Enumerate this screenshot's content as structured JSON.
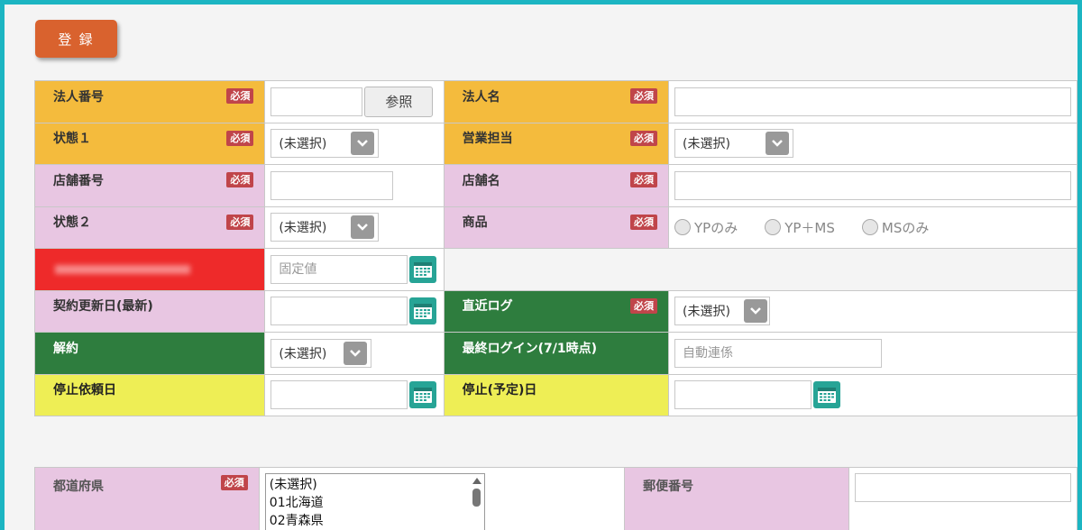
{
  "toolbar": {
    "register_label": "登 録"
  },
  "required_badge": "必須",
  "row1": {
    "corp_number_label": "法人番号",
    "corp_number_value": "",
    "ref_button": "参照",
    "corp_name_label": "法人名",
    "corp_name_value": ""
  },
  "row2": {
    "status1_label": "状態１",
    "status1_value": "(未選択)",
    "sales_label": "営業担当",
    "sales_value": "(未選択)"
  },
  "row3": {
    "store_number_label": "店舗番号",
    "store_number_value": "",
    "store_name_label": "店舗名",
    "store_name_value": ""
  },
  "row4": {
    "status2_label": "状態２",
    "status2_value": "(未選択)",
    "product_label": "商品",
    "product_options": [
      "YPのみ",
      "YP＋MS",
      "MSのみ"
    ]
  },
  "row5": {
    "fixed_value_placeholder": "固定値"
  },
  "row6": {
    "renewal_label": "契約更新日(最新)",
    "recent_log_label": "直近ログ",
    "recent_log_value": "(未選択)"
  },
  "row7": {
    "cancel_label": "解約",
    "cancel_value": "(未選択)",
    "last_login_label": "最終ログイン(7/1時点)",
    "last_login_placeholder": "自動連係"
  },
  "row8": {
    "stop_request_label": "停止依頼日",
    "stop_planned_label": "停止(予定)日"
  },
  "address": {
    "prefecture_label": "都道府県",
    "prefecture_options": [
      "(未選択)",
      "01北海道",
      "02青森県"
    ],
    "postal_label": "郵便番号",
    "postal_value": ""
  },
  "colors": {
    "orange": "#f4bb3d",
    "pink": "#e8c6e2",
    "green": "#2e7d3e",
    "yellow": "#eeee55",
    "register": "#d9622e",
    "calendar": "#27a496",
    "required": "#c0454a"
  }
}
